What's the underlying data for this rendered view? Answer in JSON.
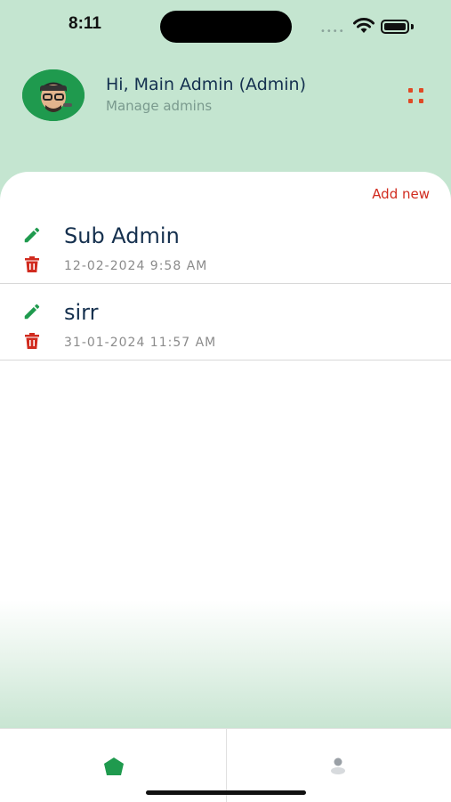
{
  "status": {
    "time": "8:11"
  },
  "header": {
    "greeting": "Hi, Main Admin (Admin)",
    "subtitle": "Manage admins"
  },
  "list": {
    "add_new_label": "Add new",
    "items": [
      {
        "name": "Sub Admin",
        "date": "12-02-2024 9:58 AM"
      },
      {
        "name": "sirr",
        "date": "31-01-2024 11:57 AM"
      }
    ]
  },
  "colors": {
    "accent_green": "#1f9a4e",
    "danger_red": "#d12b1f",
    "header_bg": "#c4e5d0",
    "title_text": "#15304e"
  },
  "icons": {
    "edit": "pencil-icon",
    "delete": "trash-icon",
    "menu": "grid-icon",
    "home": "home-icon",
    "profile": "person-icon"
  }
}
